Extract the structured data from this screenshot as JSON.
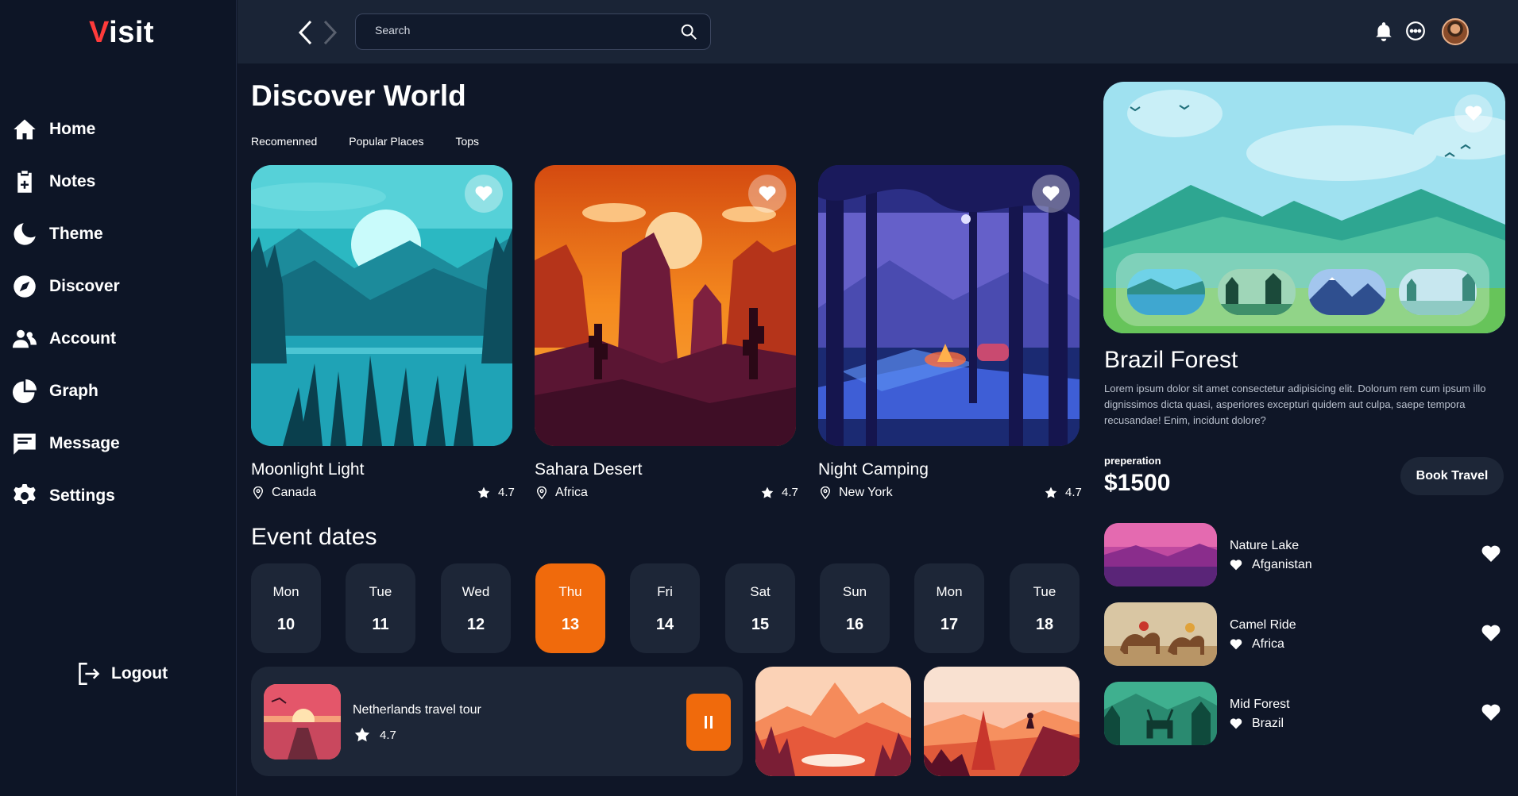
{
  "sidebar": {
    "logo_first": "V",
    "logo_rest": "isit",
    "items": [
      {
        "label": "Home",
        "icon": "home-icon"
      },
      {
        "label": "Notes",
        "icon": "notes-icon"
      },
      {
        "label": "Theme",
        "icon": "moon-icon"
      },
      {
        "label": "Discover",
        "icon": "compass-icon"
      },
      {
        "label": "Account",
        "icon": "users-icon"
      },
      {
        "label": "Graph",
        "icon": "pie-chart-icon"
      },
      {
        "label": "Message",
        "icon": "message-icon"
      },
      {
        "label": "Settings",
        "icon": "gear-icon"
      }
    ],
    "logout_label": "Logout"
  },
  "topbar": {
    "search_placeholder": "Search"
  },
  "main": {
    "title": "Discover World",
    "tabs": [
      "Recomenned",
      "Popular Places",
      "Tops"
    ],
    "cards": [
      {
        "name": "Moonlight Light",
        "location": "Canada",
        "rating": "4.7"
      },
      {
        "name": "Sahara Desert",
        "location": "Africa",
        "rating": "4.7"
      },
      {
        "name": "Night Camping",
        "location": "New York",
        "rating": "4.7"
      }
    ],
    "events_title": "Event dates",
    "days": [
      {
        "name": "Mon",
        "date": "10"
      },
      {
        "name": "Tue",
        "date": "11"
      },
      {
        "name": "Wed",
        "date": "12"
      },
      {
        "name": "Thu",
        "date": "13"
      },
      {
        "name": "Fri",
        "date": "14"
      },
      {
        "name": "Sat",
        "date": "15"
      },
      {
        "name": "Sun",
        "date": "16"
      },
      {
        "name": "Mon",
        "date": "17"
      },
      {
        "name": "Tue",
        "date": "18"
      }
    ],
    "selected_day": "Thu 13",
    "player": {
      "title": "Netherlands travel tour",
      "rating": "4.7"
    }
  },
  "right": {
    "title": "Brazil Forest",
    "description": "Lorem ipsum dolor sit amet consectetur adipisicing elit. Dolorum rem cum ipsum illo dignissimos dicta quasi, asperiores excepturi quidem aut culpa, saepe tempora recusandae! Enim, incidunt dolore?",
    "price_label": "preperation",
    "price": "$1500",
    "book_label": "Book Travel",
    "list": [
      {
        "name": "Nature Lake",
        "location": "Afganistan"
      },
      {
        "name": "Camel Ride",
        "location": "Africa"
      },
      {
        "name": "Mid Forest",
        "location": "Brazil"
      }
    ]
  },
  "colors": {
    "background": "#0f1627",
    "sidebar": "#0d1526",
    "topbar": "#1a2436",
    "card": "#1d2637",
    "accent": "#f06a0c",
    "logo_accent": "#ff3b3b"
  }
}
